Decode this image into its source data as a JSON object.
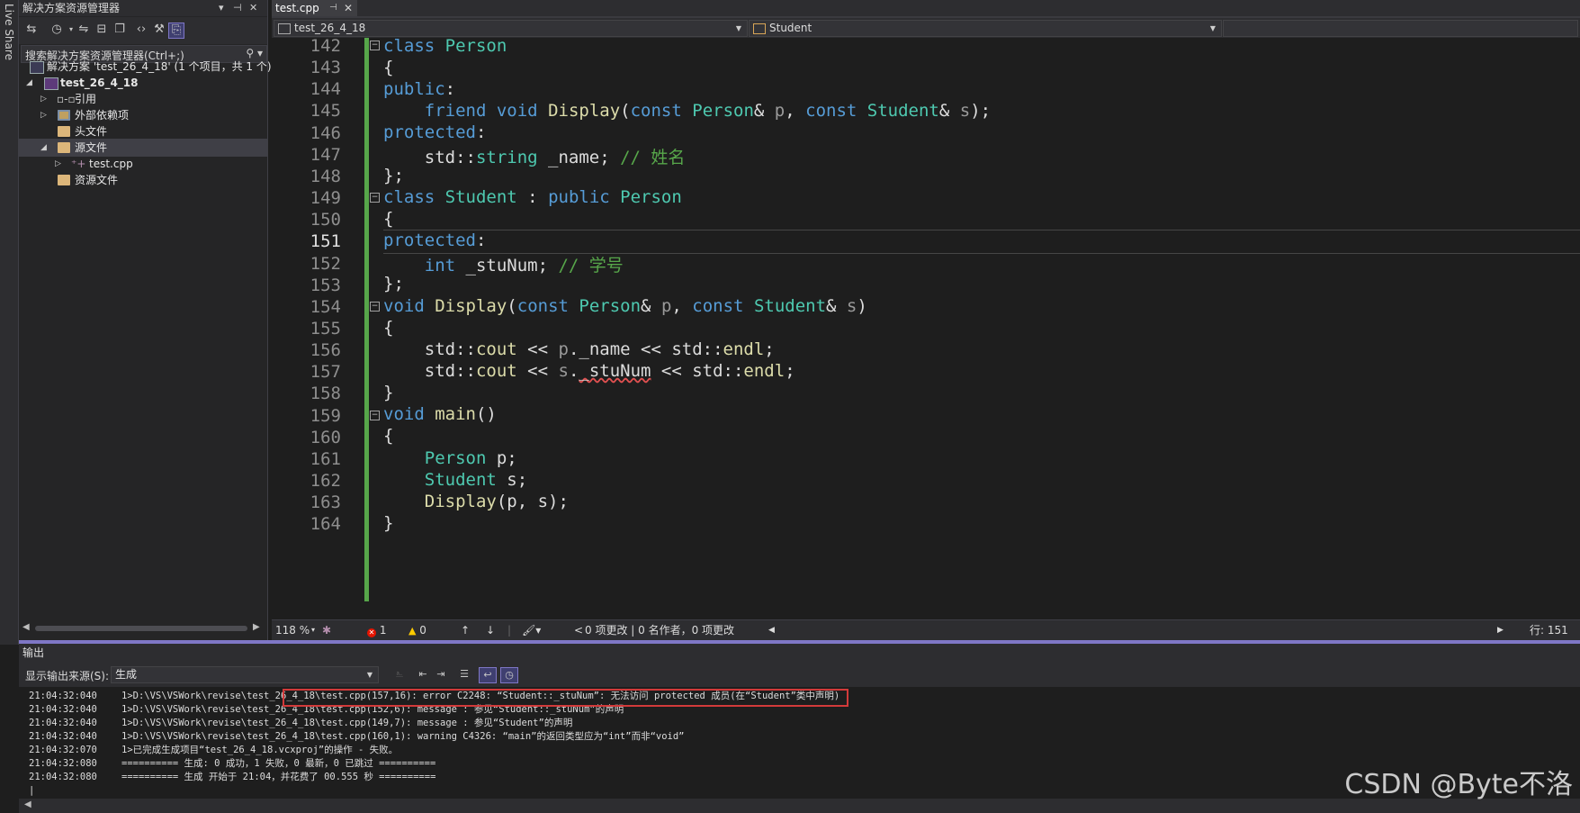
{
  "liveshare": {
    "label": "Live Share"
  },
  "solution_explorer": {
    "title": "解决方案资源管理器",
    "search_placeholder": "搜索解决方案资源管理器(Ctrl+;)",
    "items": [
      {
        "label": "解决方案 'test_26_4_18' (1 个项目，共 1 个)"
      },
      {
        "label": "test_26_4_18"
      },
      {
        "label": "引用"
      },
      {
        "label": "外部依赖项"
      },
      {
        "label": "头文件"
      },
      {
        "label": "源文件"
      },
      {
        "label": "test.cpp"
      },
      {
        "label": "资源文件"
      }
    ]
  },
  "editor": {
    "tab": {
      "label": "test.cpp"
    },
    "nav_project": "test_26_4_18",
    "nav_scope": "Student",
    "current_line": "151",
    "line_numbers": [
      "142",
      "143",
      "144",
      "145",
      "146",
      "147",
      "148",
      "149",
      "150",
      "151",
      "152",
      "153",
      "154",
      "155",
      "156",
      "157",
      "158",
      "159",
      "160",
      "161",
      "162",
      "163",
      "164"
    ]
  },
  "status": {
    "zoom": "118 %",
    "errors": "1",
    "warnings": "0",
    "changes": "0 项更改 | 0 名作者，0 项更改",
    "position": "行: 151"
  },
  "output": {
    "title": "输出",
    "source_label": "显示输出来源(S):",
    "source_value": "生成",
    "lines": [
      {
        "ts": "21:04:32:040",
        "text": "1>D:\\VS\\VSWork\\revise\\test_26_4_18\\test.cpp(157,16): error C2248: “Student::_stuNum”: 无法访问 protected 成员(在“Student”类中声明)"
      },
      {
        "ts": "21:04:32:040",
        "text": "1>D:\\VS\\VSWork\\revise\\test_26_4_18\\test.cpp(152,6): message : 参见“Student::_stuNum”的声明"
      },
      {
        "ts": "21:04:32:040",
        "text": "1>D:\\VS\\VSWork\\revise\\test_26_4_18\\test.cpp(149,7): message : 参见“Student”的声明"
      },
      {
        "ts": "21:04:32:040",
        "text": "1>D:\\VS\\VSWork\\revise\\test_26_4_18\\test.cpp(160,1): warning C4326: “main”的返回类型应为“int”而非“void”"
      },
      {
        "ts": "21:04:32:070",
        "text": "1>已完成生成项目“test_26_4_18.vcxproj”的操作 - 失败。"
      },
      {
        "ts": "21:04:32:080",
        "text": "========== 生成: 0 成功，1 失败，0 最新，0 已跳过 =========="
      },
      {
        "ts": "21:04:32:080",
        "text": "========== 生成 开始于 21:04，并花费了 00.555 秒 =========="
      }
    ]
  },
  "watermark": "CSDN @Byte不洛",
  "colors": {
    "keyword": "#569cd6",
    "type": "#4ec9b0",
    "function": "#dcdcaa",
    "comment": "#57a64a",
    "accent": "#7f77c6",
    "error_box": "#d23a3a"
  }
}
